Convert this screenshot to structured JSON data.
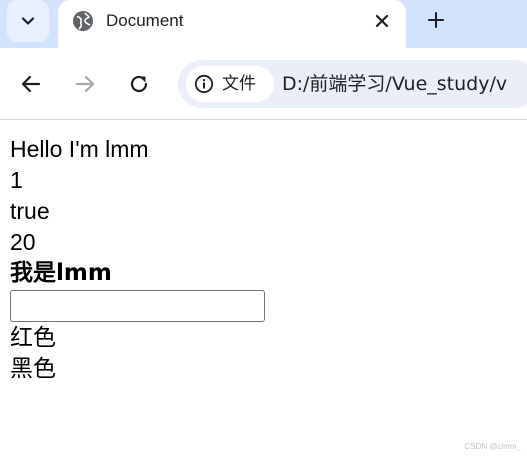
{
  "tab": {
    "title": "Document"
  },
  "toolbar": {
    "chip_label": "文件",
    "url": "D:/前端学习/Vue_study/v"
  },
  "page": {
    "line1": "Hello I'm lmm",
    "line2": "1",
    "line3": "true",
    "line4": "20",
    "bold_line": "我是lmm",
    "input_value": "",
    "option1": "红色",
    "option2": "黑色"
  },
  "watermark": "CSDN @clmm_",
  "icons": {
    "tab_menu": "chevron-down-icon",
    "favicon": "globe-icon",
    "close": "close-icon",
    "new_tab": "plus-icon",
    "back": "arrow-left-icon",
    "forward": "arrow-right-icon",
    "reload": "reload-icon",
    "site_info": "info-icon"
  },
  "colors": {
    "tabbar_bg": "#d3e3fd",
    "omnibox_bg": "#e9eef8",
    "forward_disabled": "#a8a8a8"
  }
}
